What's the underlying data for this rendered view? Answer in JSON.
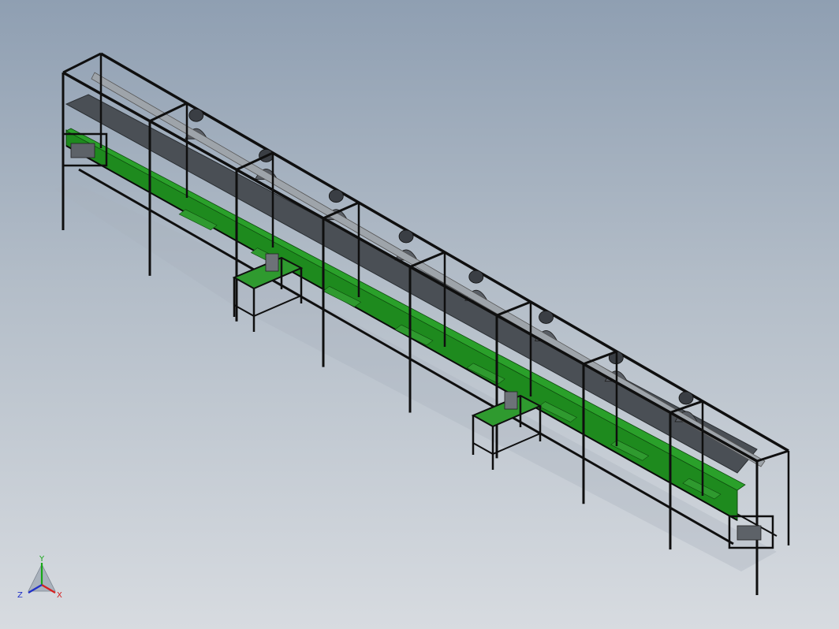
{
  "viewport": {
    "colors": {
      "bg_top": "#8f9fb2",
      "bg_bottom": "#d7dbe0",
      "frame": "#0f0f0f",
      "belt_top": "#4a4f55",
      "belt_side": "#1e8a1e",
      "tray": "#2f9a2f",
      "rail": "#9ea4aa"
    }
  },
  "model": {
    "stations": 8,
    "side_tables": 2,
    "operator_figures": 8
  },
  "triad": {
    "x_label": "X",
    "y_label": "Y",
    "z_label": "Z",
    "x_color": "#d42020",
    "y_color": "#18a818",
    "z_color": "#2030c8"
  }
}
